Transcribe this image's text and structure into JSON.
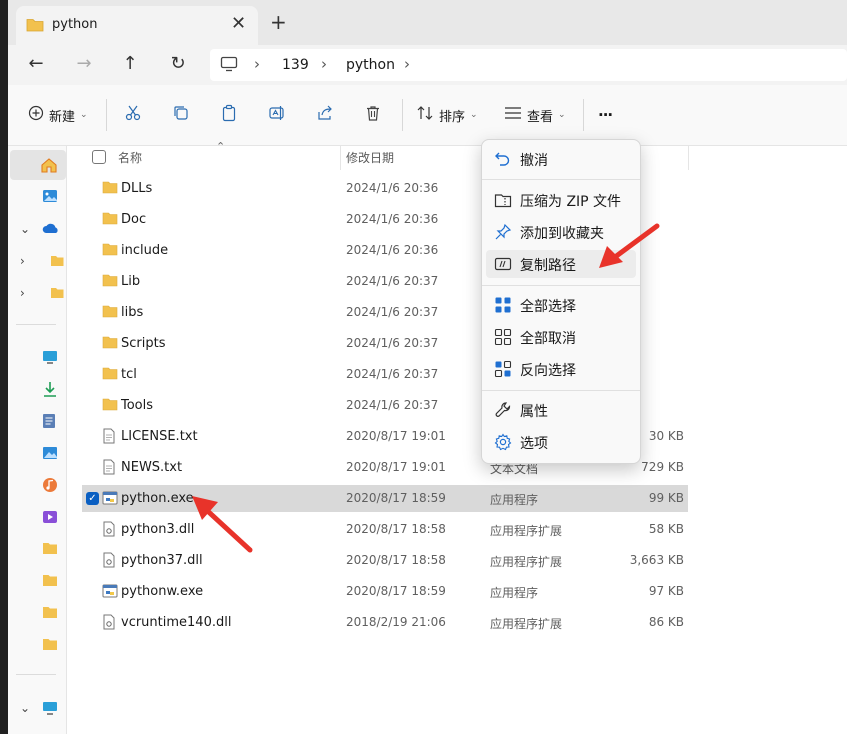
{
  "tab": {
    "title": "python",
    "close": "✕",
    "new": "+"
  },
  "breadcrumb": {
    "items": [
      "139",
      "python"
    ]
  },
  "toolbar": {
    "new_label": "新建",
    "sort_label": "排序",
    "view_label": "查看",
    "more_label": "···"
  },
  "columns": {
    "name": "名称",
    "date": "修改日期"
  },
  "files": [
    {
      "name": "DLLs",
      "date": "2024/1/6 20:36",
      "type": "",
      "size": "",
      "kind": "folder"
    },
    {
      "name": "Doc",
      "date": "2024/1/6 20:36",
      "type": "",
      "size": "",
      "kind": "folder"
    },
    {
      "name": "include",
      "date": "2024/1/6 20:36",
      "type": "",
      "size": "",
      "kind": "folder"
    },
    {
      "name": "Lib",
      "date": "2024/1/6 20:37",
      "type": "",
      "size": "",
      "kind": "folder"
    },
    {
      "name": "libs",
      "date": "2024/1/6 20:37",
      "type": "",
      "size": "",
      "kind": "folder"
    },
    {
      "name": "Scripts",
      "date": "2024/1/6 20:37",
      "type": "",
      "size": "",
      "kind": "folder"
    },
    {
      "name": "tcl",
      "date": "2024/1/6 20:37",
      "type": "",
      "size": "",
      "kind": "folder"
    },
    {
      "name": "Tools",
      "date": "2024/1/6 20:37",
      "type": "",
      "size": "",
      "kind": "folder"
    },
    {
      "name": "LICENSE.txt",
      "date": "2020/8/17 19:01",
      "type": "",
      "size": "30 KB",
      "kind": "text"
    },
    {
      "name": "NEWS.txt",
      "date": "2020/8/17 19:01",
      "type": "文本文档",
      "size": "729 KB",
      "kind": "text"
    },
    {
      "name": "python.exe",
      "date": "2020/8/17 18:59",
      "type": "应用程序",
      "size": "99 KB",
      "kind": "exe",
      "selected": true
    },
    {
      "name": "python3.dll",
      "date": "2020/8/17 18:58",
      "type": "应用程序扩展",
      "size": "58 KB",
      "kind": "dll"
    },
    {
      "name": "python37.dll",
      "date": "2020/8/17 18:58",
      "type": "应用程序扩展",
      "size": "3,663 KB",
      "kind": "dll"
    },
    {
      "name": "pythonw.exe",
      "date": "2020/8/17 18:59",
      "type": "应用程序",
      "size": "97 KB",
      "kind": "exe"
    },
    {
      "name": "vcruntime140.dll",
      "date": "2018/2/19 21:06",
      "type": "应用程序扩展",
      "size": "86 KB",
      "kind": "dll"
    }
  ],
  "context_menu": {
    "undo": "撤消",
    "zip": "压缩为 ZIP 文件",
    "pin": "添加到收藏夹",
    "copy_path": "复制路径",
    "select_all": "全部选择",
    "select_none": "全部取消",
    "invert": "反向选择",
    "properties": "属性",
    "options": "选项"
  },
  "colors": {
    "accent": "#0a5fc2",
    "folder": "#f2c14e",
    "arrow": "#e8332a"
  }
}
